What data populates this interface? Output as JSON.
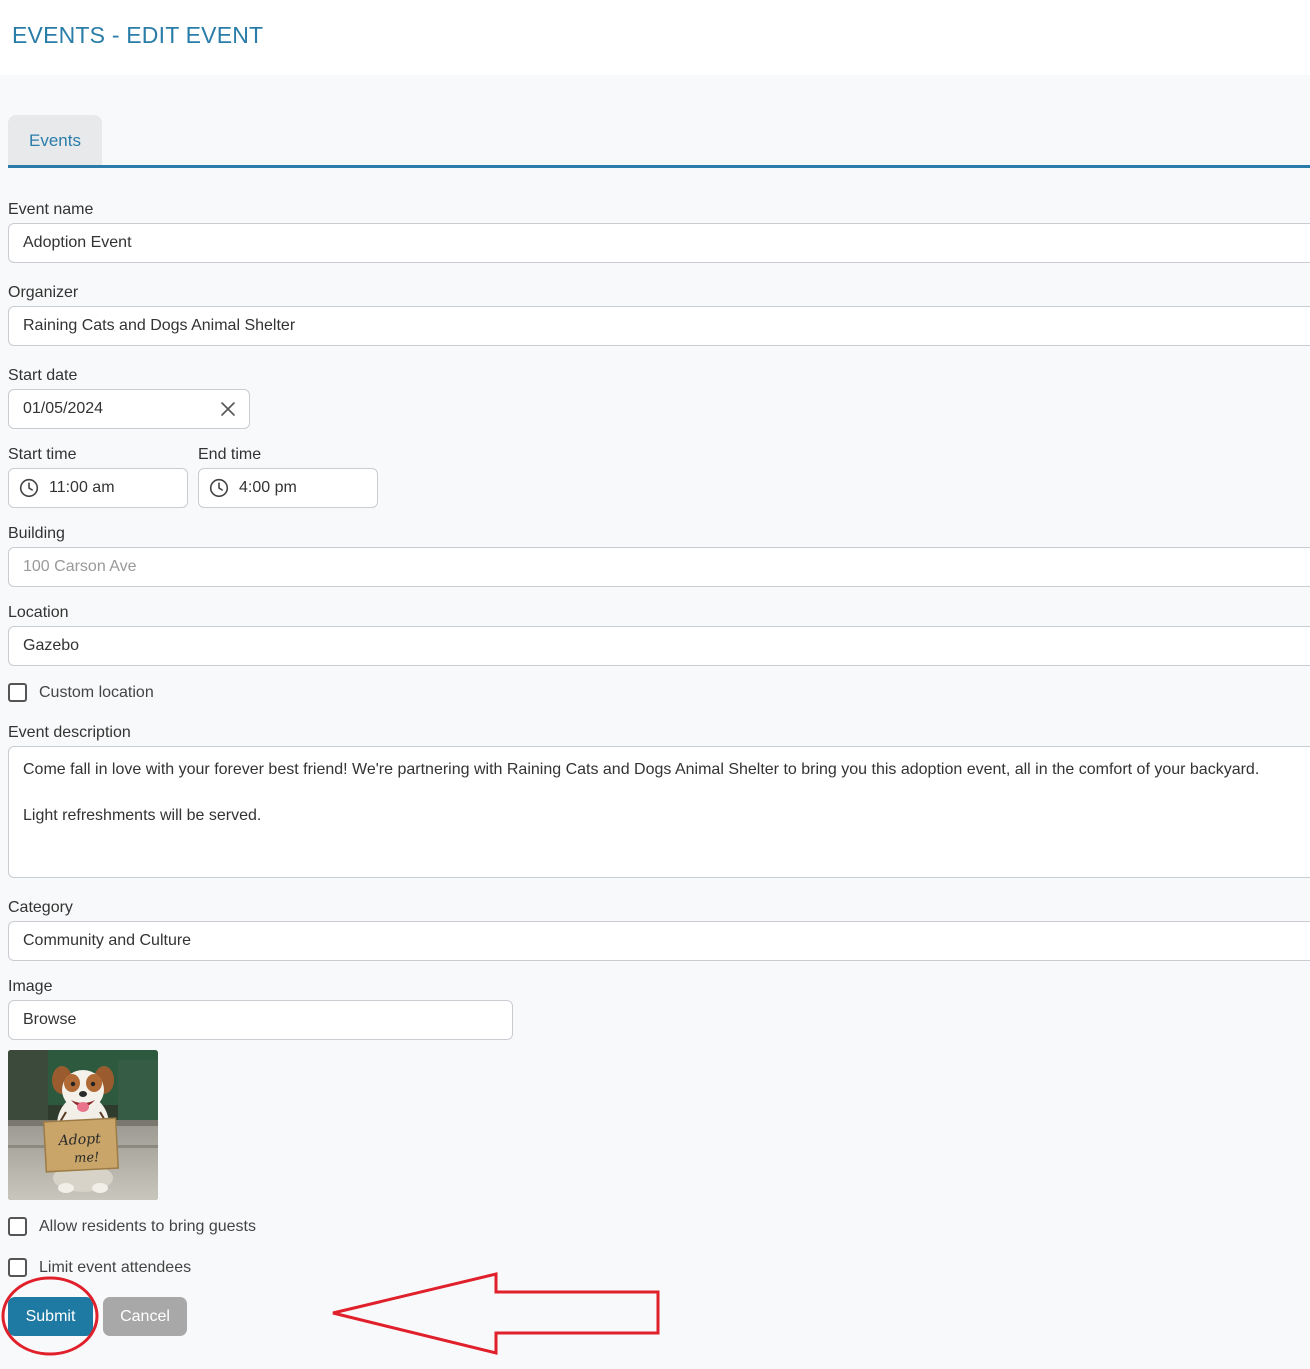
{
  "header": {
    "title": "EVENTS - EDIT EVENT"
  },
  "tabs": [
    {
      "label": "Events",
      "active": true
    }
  ],
  "form": {
    "event_name": {
      "label": "Event name",
      "value": "Adoption Event"
    },
    "organizer": {
      "label": "Organizer",
      "value": "Raining Cats and Dogs Animal Shelter"
    },
    "start_date": {
      "label": "Start date",
      "value": "01/05/2024"
    },
    "start_time": {
      "label": "Start time",
      "value": "11:00 am"
    },
    "end_time": {
      "label": "End time",
      "value": "4:00 pm"
    },
    "building": {
      "label": "Building",
      "value": "100 Carson Ave"
    },
    "location": {
      "label": "Location",
      "value": "Gazebo"
    },
    "custom_location": {
      "label": "Custom location",
      "checked": false
    },
    "description": {
      "label": "Event description",
      "line1": "Come fall in love with your forever best friend! We're partnering with Raining Cats and Dogs Animal Shelter to bring you this adoption event, all in the comfort of your backyard.",
      "line2": "Light refreshments will be served."
    },
    "category": {
      "label": "Category",
      "value": "Community and Culture"
    },
    "image": {
      "label": "Image",
      "browse": "Browse",
      "sign_line1": "Adopt",
      "sign_line2": "me!"
    },
    "allow_guests": {
      "label": "Allow residents to bring guests",
      "checked": false
    },
    "limit_attendees": {
      "label": "Limit event attendees",
      "checked": false
    }
  },
  "actions": {
    "submit": "Submit",
    "cancel": "Cancel"
  },
  "colors": {
    "accent": "#2a7da8",
    "submit": "#1f7aa3",
    "cancel": "#a8a8a8",
    "annotation": "#e0202a"
  },
  "icons": {
    "clear": "close-icon",
    "time": "clock-icon",
    "arrow": "arrow-left-icon"
  }
}
